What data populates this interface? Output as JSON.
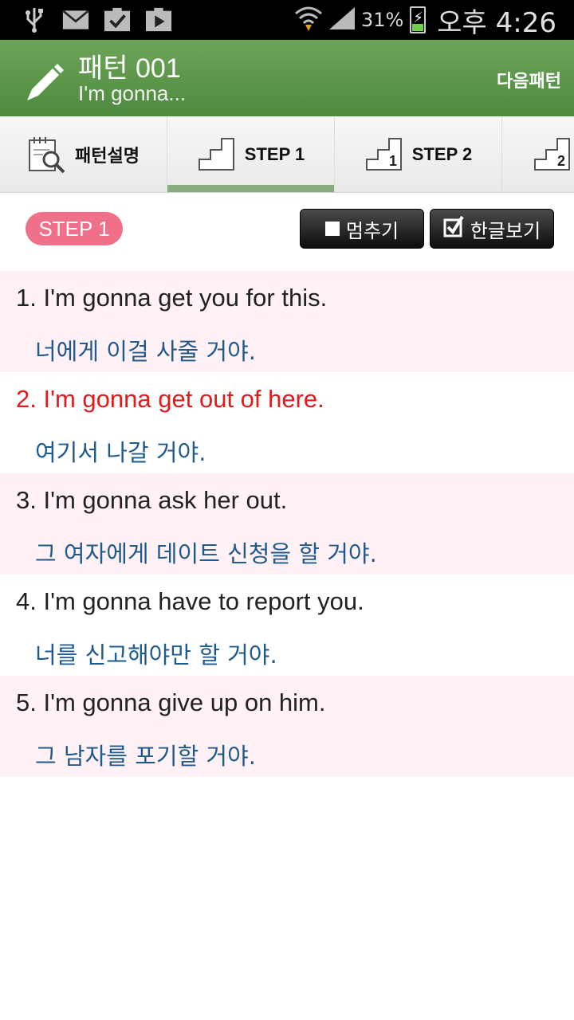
{
  "status_bar": {
    "icons": [
      "usb-icon",
      "mail-icon",
      "clipboard-check-icon",
      "play-store-icon",
      "wifi-icon",
      "signal-icon",
      "battery-charging-icon"
    ],
    "battery_percent": "31%",
    "time": "오후 4:26"
  },
  "header": {
    "title": "패턴 001",
    "subtitle": "I'm gonna...",
    "next_label": "다음패턴"
  },
  "tabs": [
    {
      "label": "패턴설명",
      "icon": "calendar-search-icon"
    },
    {
      "label": "STEP 1",
      "icon": "steps-icon",
      "active": true
    },
    {
      "label": "STEP 2",
      "icon": "steps-1-icon",
      "badge": "1"
    },
    {
      "label": "",
      "icon": "steps-2-icon",
      "badge": "2"
    }
  ],
  "controls": {
    "step_badge": "STEP 1",
    "stop_label": "멈추기",
    "korean_label": "한글보기"
  },
  "sentences": [
    {
      "en": "1. I'm gonna get you for this.",
      "ko": "너에게 이걸 사줄 거야."
    },
    {
      "en": "2. I'm gonna get out of here.",
      "ko": "여기서 나갈 거야.",
      "playing": true
    },
    {
      "en": "3. I'm gonna ask her out.",
      "ko": "그 여자에게 데이트 신청을 할 거야."
    },
    {
      "en": "4. I'm gonna have to report you.",
      "ko": "너를 신고해야만 할 거야."
    },
    {
      "en": "5. I'm gonna give up on him.",
      "ko": "그 남자를 포기할 거야."
    }
  ],
  "colors": {
    "header_green": "#5a9648",
    "highlight_red": "#e21a1a",
    "korean_blue": "#1f5a8c",
    "alt_row_pink": "#fff1f6",
    "step_badge_pink": "#f0708a"
  }
}
